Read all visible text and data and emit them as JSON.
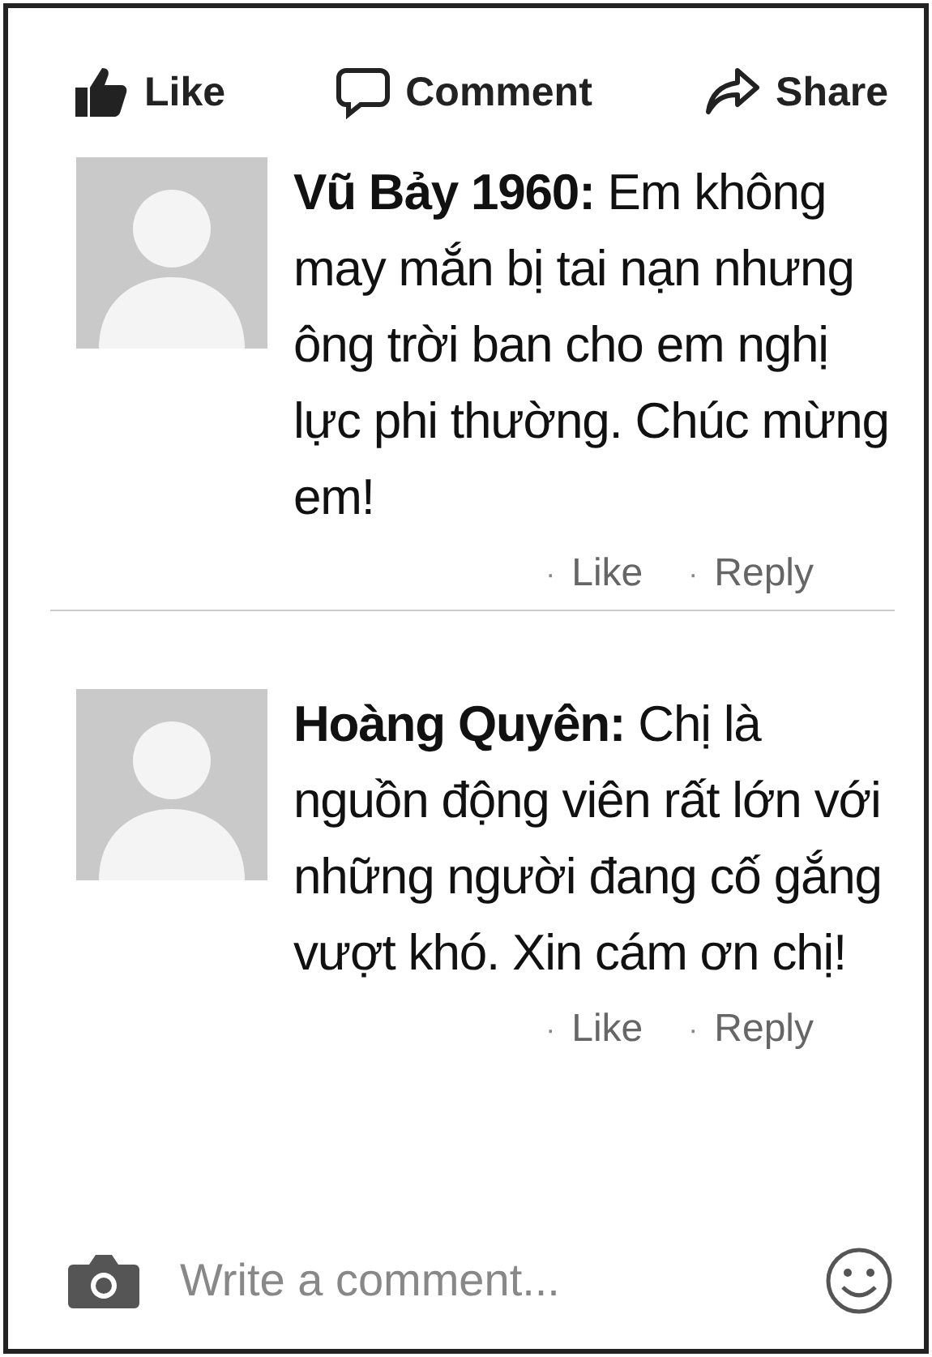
{
  "actions": [
    {
      "kind": "like",
      "label": "Like"
    },
    {
      "kind": "comment",
      "label": "Comment"
    },
    {
      "kind": "share",
      "label": "Share"
    }
  ],
  "comments": [
    {
      "text": "**Vũ Bảy 1960:** Em không may mắn bị tai nạn nhưng ông trời ban cho em nghị lực phi thường. Chúc mừng em!",
      "links": [
        {
          "dot": "·",
          "label": "Like"
        },
        {
          "dot": "·",
          "label": "Reply"
        }
      ]
    },
    {
      "text": "**Hoàng Quyên:** Chị là nguồn động viên rất lớn với những người đang cố gắng vượt khó. Xin cám ơn chị!",
      "links": [
        {
          "dot": "·",
          "label": "Like"
        },
        {
          "dot": "·",
          "label": "Reply"
        }
      ]
    }
  ],
  "composer": {
    "placeholder": "Write a comment..."
  }
}
